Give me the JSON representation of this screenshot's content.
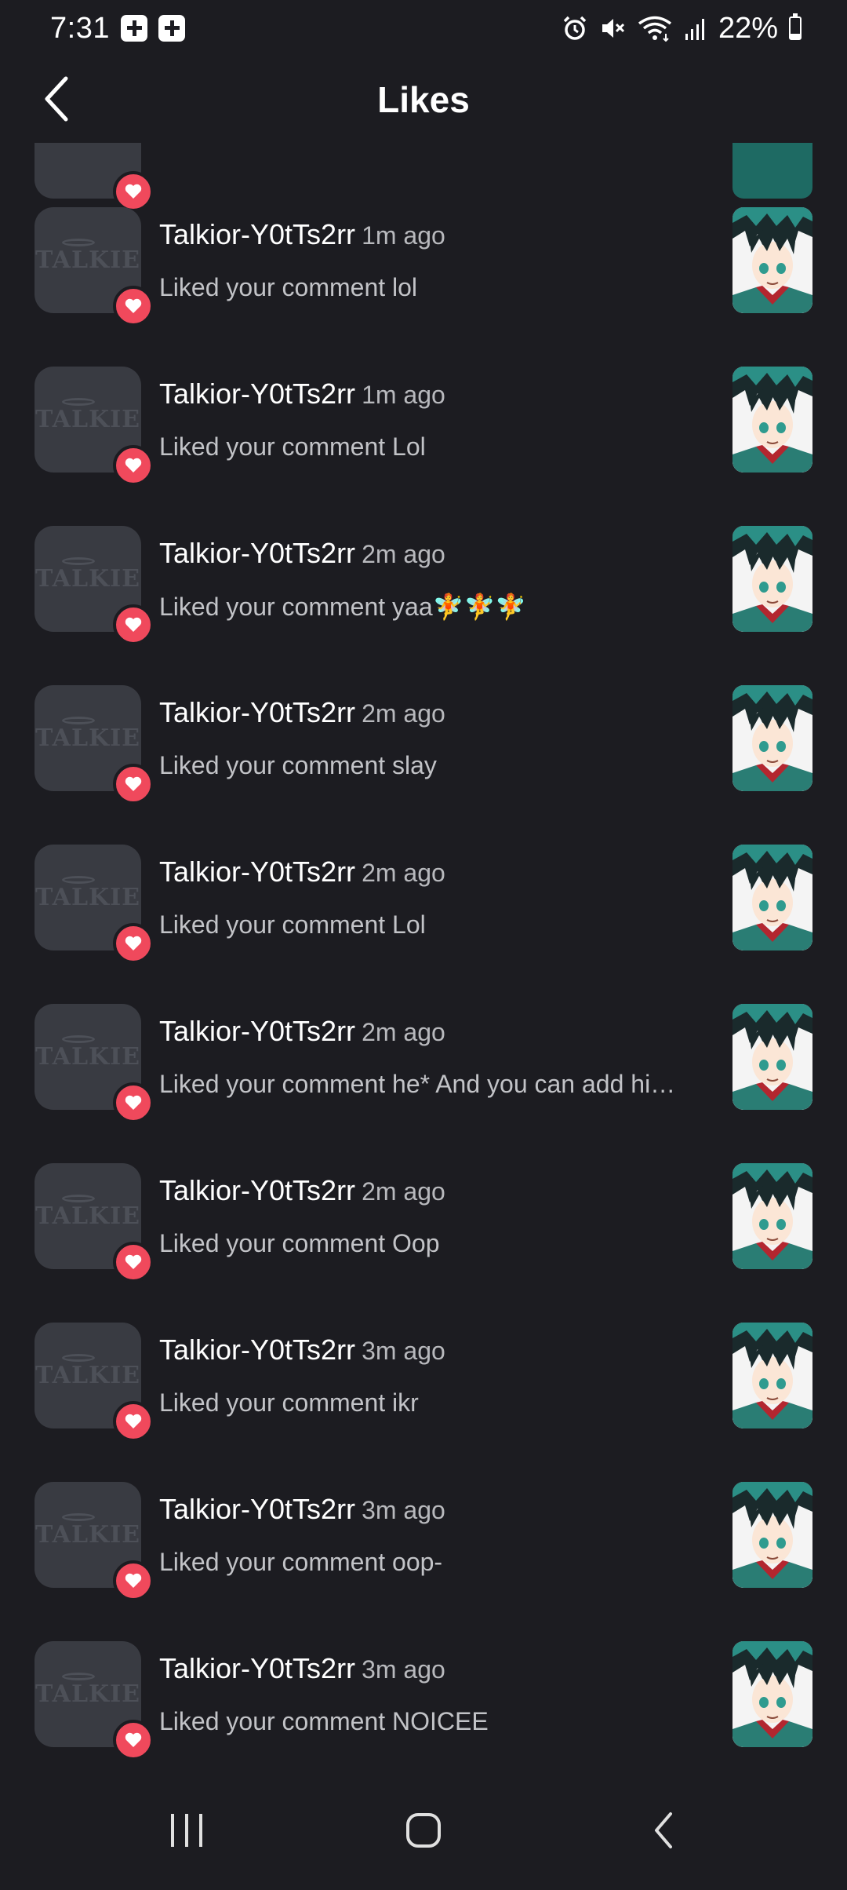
{
  "status_bar": {
    "time": "7:31",
    "battery": "22%",
    "battery_level": 0.22,
    "icons": [
      "notification-icon",
      "notification-icon",
      "alarm-icon",
      "mute-icon",
      "wifi-icon",
      "signal-icon",
      "battery-icon"
    ]
  },
  "header": {
    "title": "Likes",
    "back_icon": "chevron-left-icon"
  },
  "avatar_logo_text": "TALKIE",
  "items": [
    {
      "name": "Talkior-Y0tTs2rr",
      "time": "1m ago",
      "text": "Liked your comment lol"
    },
    {
      "name": "Talkior-Y0tTs2rr",
      "time": "1m ago",
      "text": "Liked your comment Lol"
    },
    {
      "name": "Talkior-Y0tTs2rr",
      "time": "2m ago",
      "text": "Liked your comment yaa🧚🧚🧚"
    },
    {
      "name": "Talkior-Y0tTs2rr",
      "time": "2m ago",
      "text": "Liked your comment slay"
    },
    {
      "name": "Talkior-Y0tTs2rr",
      "time": "2m ago",
      "text": "Liked your comment Lol"
    },
    {
      "name": "Talkior-Y0tTs2rr",
      "time": "2m ago",
      "text": "Liked your comment he* And you can add hi…"
    },
    {
      "name": "Talkior-Y0tTs2rr",
      "time": "2m ago",
      "text": "Liked your comment Oop"
    },
    {
      "name": "Talkior-Y0tTs2rr",
      "time": "3m ago",
      "text": "Liked your comment ikr"
    },
    {
      "name": "Talkior-Y0tTs2rr",
      "time": "3m ago",
      "text": "Liked your comment oop-"
    },
    {
      "name": "Talkior-Y0tTs2rr",
      "time": "3m ago",
      "text": "Liked your comment NOICEE"
    }
  ],
  "colors": {
    "background": "#1c1c21",
    "heart_badge": "#f0495c",
    "avatar_bg": "#393b42"
  },
  "nav_bar": {
    "icons": [
      "recent-apps-icon",
      "home-icon",
      "back-icon"
    ]
  }
}
